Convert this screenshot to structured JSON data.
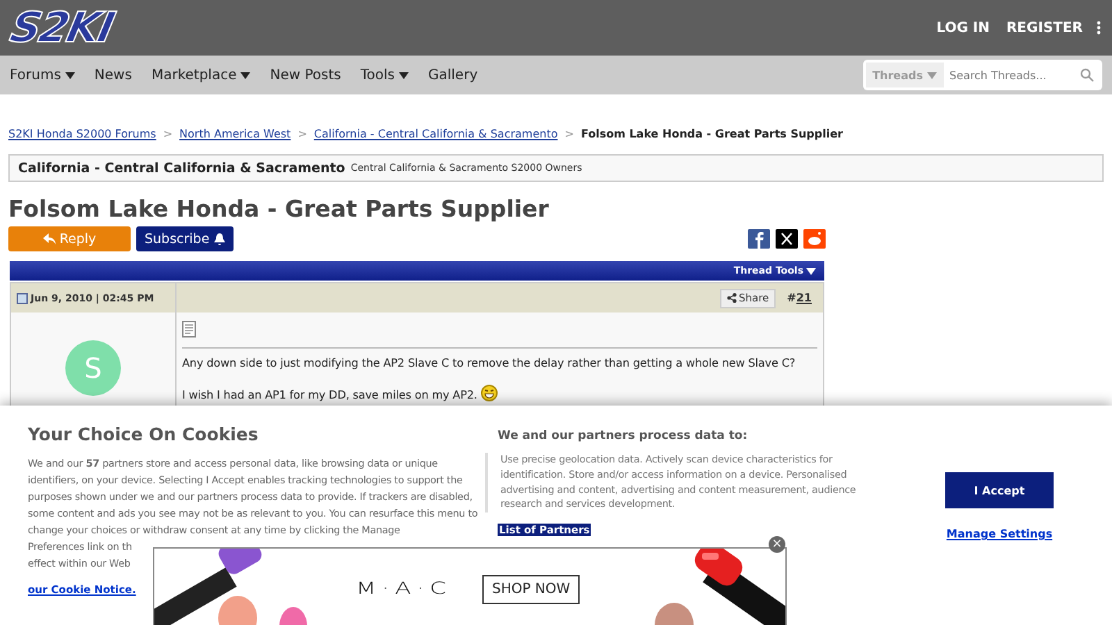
{
  "header": {
    "logo": "S2KI",
    "actions": [
      "LOG IN",
      "REGISTER"
    ]
  },
  "nav": {
    "items": [
      {
        "label": "Forums",
        "dropdown": true
      },
      {
        "label": "News",
        "dropdown": false
      },
      {
        "label": "Marketplace",
        "dropdown": true
      },
      {
        "label": "New Posts",
        "dropdown": false
      },
      {
        "label": "Tools",
        "dropdown": true
      },
      {
        "label": "Gallery",
        "dropdown": false
      }
    ],
    "search": {
      "scope": "Threads",
      "placeholder": "Search Threads..."
    }
  },
  "breadcrumbs": {
    "separator": ">",
    "links": [
      "S2KI Honda S2000 Forums",
      "North America West",
      "California - Central California & Sacramento"
    ],
    "current": "Folsom Lake Honda - Great Parts Supplier"
  },
  "forum": {
    "title": "California - Central California & Sacramento",
    "description": "Central California & Sacramento S2000 Owners"
  },
  "thread": {
    "title": "Folsom Lake Honda - Great Parts Supplier",
    "reply": "Reply",
    "subscribe": "Subscribe",
    "tools": "Thread Tools"
  },
  "post": {
    "date": "Jun 9, 2010 | 02:45 PM",
    "share": "Share",
    "number_prefix": "#",
    "number": "21",
    "avatar": "S",
    "paragraphs": [
      "Any down side to just modifying the AP2 Slave C to remove the delay rather than getting a whole new Slave C?",
      "I wish I had an AP1 for my DD, save miles on my AP2."
    ]
  },
  "cookies": {
    "title": "Your Choice On Cookies",
    "text": "We and our **57** partners store and access personal data, like browsing data or unique identifiers, on your device. Selecting I Accept enables tracking technologies to support the purposes shown under we and our partners process data to provide. If trackers are disabled, some content and ads you see may not be as relevant to you. You can resurface this menu to change your choices or withdraw consent at any time by clicking the Manage",
    "partial_lines": [
      "Preferences link on th",
      "effect within our Web"
    ],
    "notice_link": "our Cookie Notice.",
    "purposes_title": "We and our partners process data to:",
    "purposes": "Use precise geolocation data. Actively scan device characteristics for identification. Store and/or access information on a device. Personalised advertising and content, advertising and content measurement, audience research and services development.",
    "partners_link": "List of Partners",
    "accept": "I Accept",
    "manage": "Manage Settings"
  },
  "ad": {
    "brand": "M·A·C",
    "button": "SHOP NOW",
    "close": "×"
  }
}
